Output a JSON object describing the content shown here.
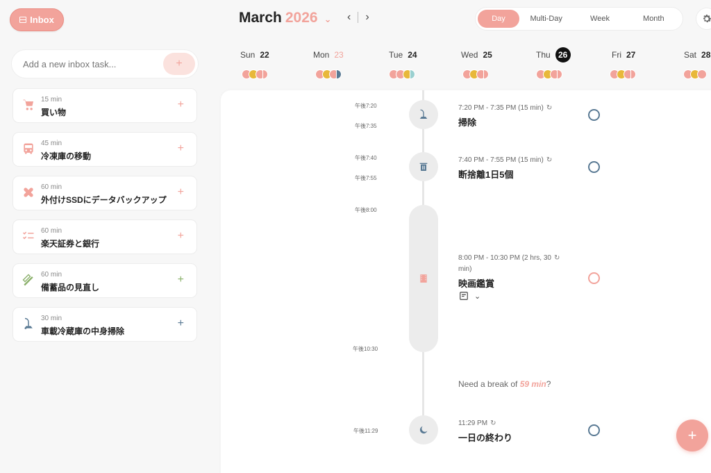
{
  "header": {
    "inbox_label": "Inbox",
    "month": "March",
    "year": "2026",
    "view_tabs": [
      "Day",
      "Multi-Day",
      "Week",
      "Month"
    ],
    "active_view": "Day"
  },
  "inbox": {
    "add_placeholder": "Add a new inbox task...",
    "tasks": [
      {
        "duration": "15 min",
        "name": "買い物",
        "icon": "shopping-cart-icon",
        "color": "#f2a39b"
      },
      {
        "duration": "45 min",
        "name": "冷凍庫の移動",
        "icon": "bus-icon",
        "color": "#f2a39b"
      },
      {
        "duration": "60 min",
        "name": "外付けSSDにデータバックアップ",
        "icon": "bandage-icon",
        "color": "#f2a39b"
      },
      {
        "duration": "60 min",
        "name": "楽天証券と銀行",
        "icon": "checklist-icon",
        "color": "#f2a39b"
      },
      {
        "duration": "60 min",
        "name": "備蓄品の見直し",
        "icon": "pencil-ruler-icon",
        "color": "#8ab06a"
      },
      {
        "duration": "30 min",
        "name": "車載冷蔵庫の中身掃除",
        "icon": "vacuum-icon",
        "color": "#5a7a94"
      }
    ]
  },
  "days": [
    {
      "dow": "Sun",
      "num": "22"
    },
    {
      "dow": "Mon",
      "num": "23"
    },
    {
      "dow": "Tue",
      "num": "24"
    },
    {
      "dow": "Wed",
      "num": "25"
    },
    {
      "dow": "Thu",
      "num": "26"
    },
    {
      "dow": "Fri",
      "num": "27"
    },
    {
      "dow": "Sat",
      "num": "28"
    }
  ],
  "timeline": {
    "labels": [
      "午後7:20",
      "午後7:35",
      "午後7:40",
      "午後7:55",
      "午後8:00",
      "午後10:30",
      "午後11:29"
    ],
    "events": [
      {
        "time": "7:20 PM - 7:35 PM (15 min)",
        "title": "掃除",
        "icon": "vacuum-icon"
      },
      {
        "time": "7:40 PM - 7:55 PM (15 min)",
        "title": "断捨離1日5個",
        "icon": "trash-icon"
      },
      {
        "time_line1": "8:00 PM - 10:30 PM (2 hrs, 30",
        "time_line2": "min)",
        "title": "映画鑑賞",
        "icon": "film-icon"
      },
      {
        "time": "11:29 PM",
        "title": "一日の終わり",
        "icon": "moon-icon"
      }
    ],
    "break_prefix": "Need a break of",
    "break_minutes": "59 min",
    "break_suffix": "?"
  },
  "colors": {
    "accent": "#f2a39b",
    "blue": "#5a7a94",
    "yellow": "#e8b83a"
  }
}
